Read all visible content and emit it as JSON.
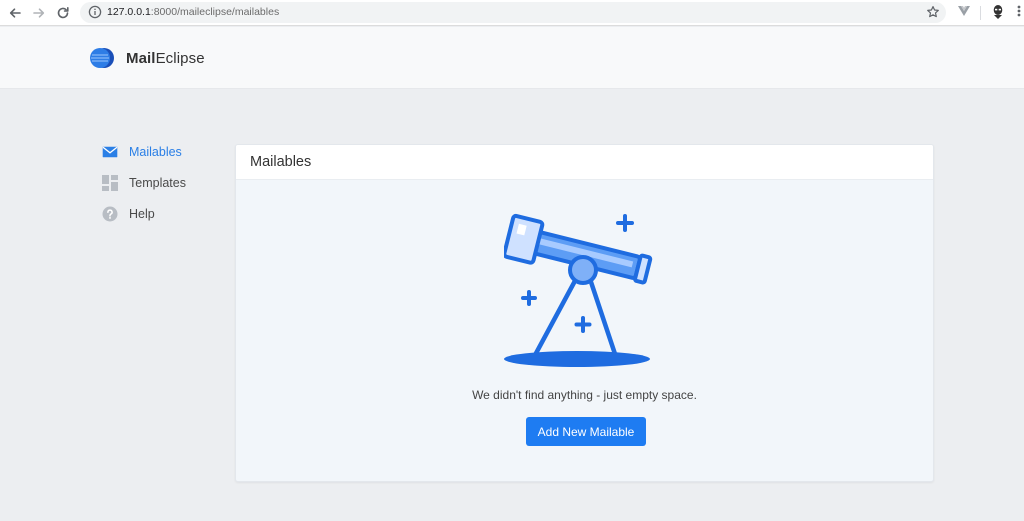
{
  "browser": {
    "url_host": "127.0.0.1",
    "url_path": ":8000/maileclipse/mailables",
    "icons": [
      "back-icon",
      "forward-icon",
      "reload-icon",
      "info-icon",
      "star-icon",
      "vuejs-devtools-icon",
      "profile-icon",
      "menu-icon"
    ]
  },
  "app": {
    "brand_bold": "Mail",
    "brand_rest": "Eclipse"
  },
  "sidebar": {
    "items": [
      {
        "label": "Mailables",
        "icon": "envelope-icon",
        "active": true
      },
      {
        "label": "Templates",
        "icon": "grid-icon",
        "active": false
      },
      {
        "label": "Help",
        "icon": "help-icon",
        "active": false
      }
    ]
  },
  "main": {
    "title": "Mailables",
    "empty_message": "We didn't find anything - just empty space.",
    "add_button_label": "Add New Mailable",
    "illustration": "telescope-illustration"
  },
  "colors": {
    "accent": "#1e7cf2",
    "sidebar_active": "#2a7fe6",
    "background": "#eceef1",
    "card_body": "#f2f6fa"
  }
}
